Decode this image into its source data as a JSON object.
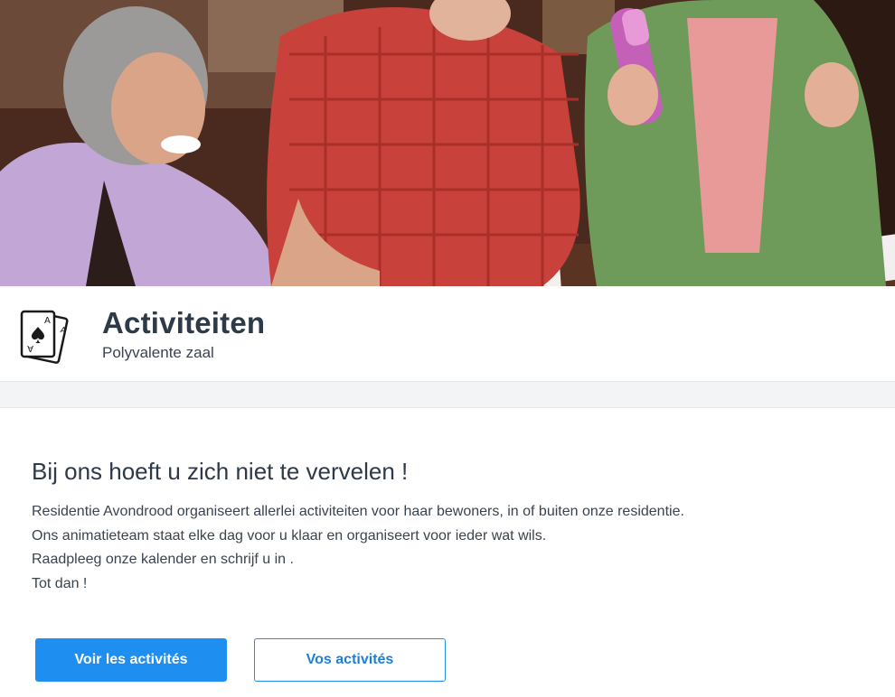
{
  "hero": {
    "image": "seniors-playing-bingo-photo"
  },
  "activity": {
    "icon": "playing-cards-icon",
    "title": "Activiteiten",
    "subtitle": "Polyvalente zaal"
  },
  "content": {
    "headline": "Bij ons hoeft u zich niet te vervelen !",
    "paragraphs": [
      "Residentie Avondrood organiseert allerlei activiteiten voor haar bewoners, in of buiten onze residentie.",
      "Ons animatieteam staat elke dag voor u klaar en organiseert voor ieder wat wils.",
      "Raadpleeg onze kalender en schrijf u in .",
      "Tot dan !"
    ]
  },
  "buttons": {
    "primary_label": "Voir les activités",
    "secondary_label": "Vos activités"
  },
  "colors": {
    "accent": "#1f8ef1",
    "title": "#2e3a48",
    "band": "#f3f4f6"
  }
}
